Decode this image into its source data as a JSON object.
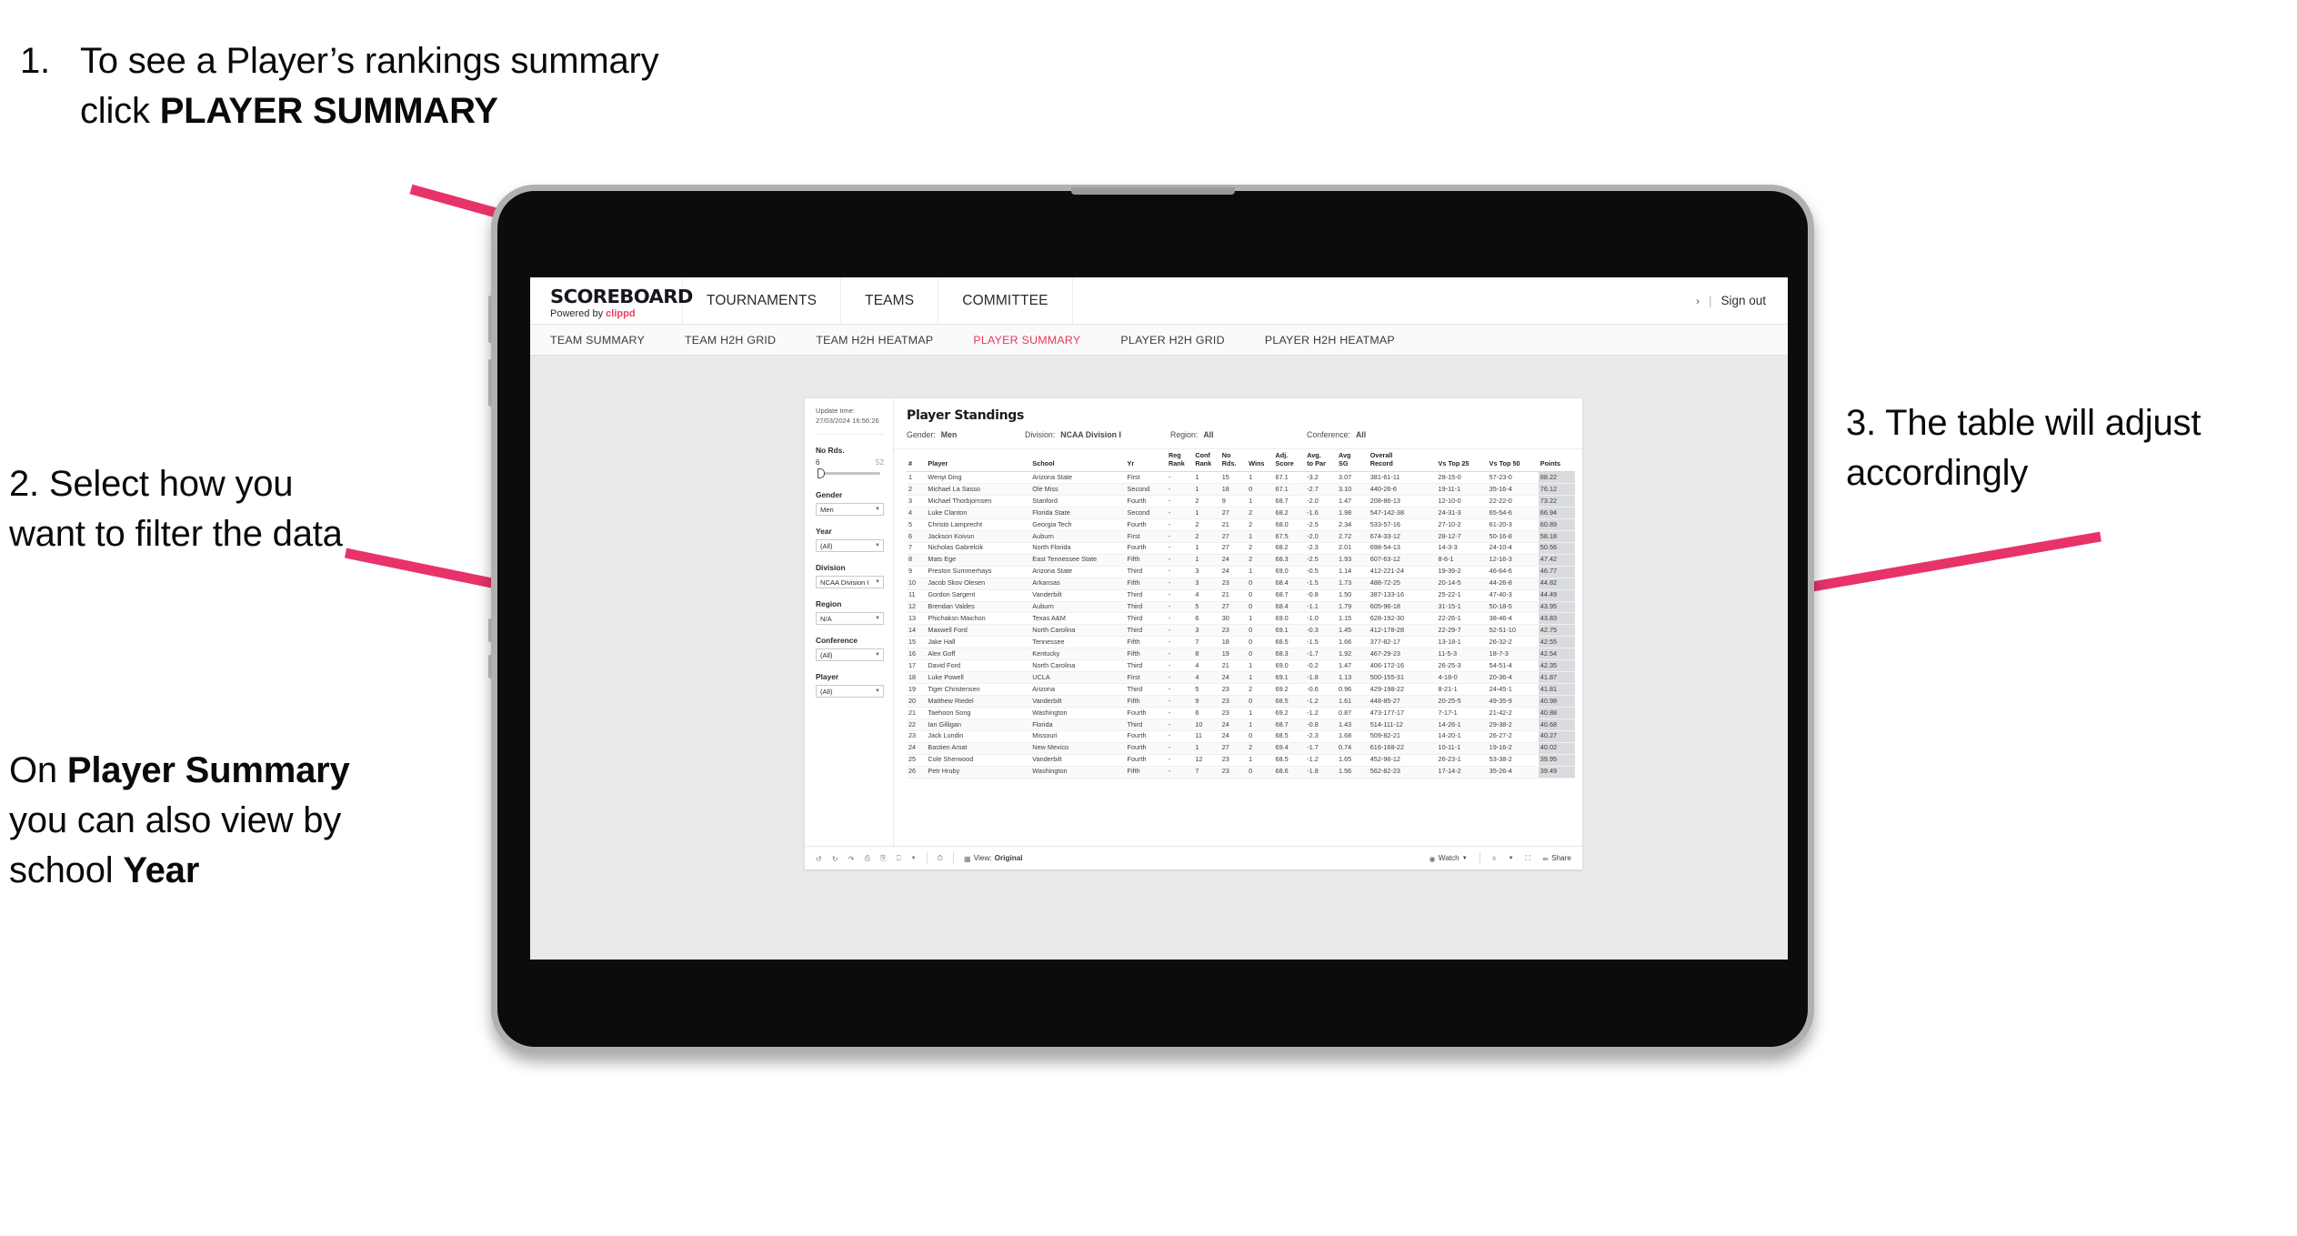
{
  "annotations": {
    "step1": {
      "number": "1.",
      "text_before": "To see a Player’s rankings summary click ",
      "bold": "PLAYER SUMMARY"
    },
    "step2": {
      "text": "2. Select how you want to filter the data"
    },
    "step2b": {
      "pre": "On ",
      "bold1": "Player Summary",
      "mid": " you can also view by school ",
      "bold2": "Year"
    },
    "step3": {
      "text": "3. The table will adjust accordingly"
    },
    "arrow_color": "#e8336a"
  },
  "app": {
    "brand": {
      "title": "SCOREBOARD",
      "powered_prefix": "Powered by ",
      "powered_brand": "clippd"
    },
    "top_nav": [
      {
        "label": "TOURNAMENTS"
      },
      {
        "label": "TEAMS"
      },
      {
        "label": "COMMITTEE"
      }
    ],
    "account": {
      "caret": "›",
      "separator": "|",
      "sign_out": "Sign out"
    },
    "sub_nav": [
      {
        "label": "TEAM SUMMARY",
        "active": false
      },
      {
        "label": "TEAM H2H GRID",
        "active": false
      },
      {
        "label": "TEAM H2H HEATMAP",
        "active": false
      },
      {
        "label": "PLAYER SUMMARY",
        "active": true
      },
      {
        "label": "PLAYER H2H GRID",
        "active": false
      },
      {
        "label": "PLAYER H2H HEATMAP",
        "active": false
      }
    ],
    "accent_color": "#e8365f"
  },
  "viz": {
    "update": {
      "label": "Update time:",
      "value": "27/03/2024 16:56:26"
    },
    "title": "Player Standings",
    "meta": [
      {
        "label": "Gender:",
        "value": "Men"
      },
      {
        "label": "Division:",
        "value": "NCAA Division I"
      },
      {
        "label": "Region:",
        "value": "All"
      },
      {
        "label": "Conference:",
        "value": "All"
      }
    ],
    "filters": {
      "rounds": {
        "label": "No Rds.",
        "min": "6",
        "max": "52"
      },
      "selects": [
        {
          "label": "Gender",
          "value": "Men"
        },
        {
          "label": "Year",
          "value": "(All)"
        },
        {
          "label": "Division",
          "value": "NCAA Division I"
        },
        {
          "label": "Region",
          "value": "N/A"
        },
        {
          "label": "Conference",
          "value": "(All)"
        },
        {
          "label": "Player",
          "value": "(All)"
        }
      ]
    },
    "footer": {
      "view_label": "View:",
      "view_value": "Original",
      "watch": "Watch",
      "share": "Share"
    }
  },
  "chart_data": {
    "type": "table",
    "title": "Player Standings",
    "columns": [
      "#",
      "Player",
      "School",
      "Yr",
      "Reg Rank",
      "Conf Rank",
      "No Rds.",
      "Wins",
      "Adj. Score",
      "Avg. to Par",
      "Avg SG",
      "Overall Record",
      "Vs Top 25",
      "Vs Top 50",
      "Points"
    ],
    "column_headers_two_line": [
      {
        "l1": "#",
        "l2": ""
      },
      {
        "l1": "Player",
        "l2": ""
      },
      {
        "l1": "School",
        "l2": ""
      },
      {
        "l1": "Yr",
        "l2": ""
      },
      {
        "l1": "Reg",
        "l2": "Rank"
      },
      {
        "l1": "Conf",
        "l2": "Rank"
      },
      {
        "l1": "No",
        "l2": "Rds."
      },
      {
        "l1": "Wins",
        "l2": ""
      },
      {
        "l1": "Adj.",
        "l2": "Score"
      },
      {
        "l1": "Avg.",
        "l2": "to Par"
      },
      {
        "l1": "Avg",
        "l2": "SG"
      },
      {
        "l1": "Overall",
        "l2": "Record"
      },
      {
        "l1": "Vs Top 25",
        "l2": ""
      },
      {
        "l1": "Vs Top 50",
        "l2": ""
      },
      {
        "l1": "Points",
        "l2": ""
      }
    ],
    "rows": [
      [
        "1",
        "Wenyi Ding",
        "Arizona State",
        "First",
        "-",
        "1",
        "15",
        "1",
        "67.1",
        "-3.2",
        "3.07",
        "381-61-11",
        "28-15-0",
        "57-23-0",
        "88.22"
      ],
      [
        "2",
        "Michael La Sasso",
        "Ole Miss",
        "Second",
        "-",
        "1",
        "18",
        "0",
        "67.1",
        "-2.7",
        "3.10",
        "440-26-6",
        "19-11-1",
        "35-16-4",
        "76.12"
      ],
      [
        "3",
        "Michael Thorbjornsen",
        "Stanford",
        "Fourth",
        "-",
        "2",
        "9",
        "1",
        "68.7",
        "-2.0",
        "1.47",
        "208-86-13",
        "12-10-0",
        "22-22-0",
        "73.22"
      ],
      [
        "4",
        "Luke Clanton",
        "Florida State",
        "Second",
        "-",
        "1",
        "27",
        "2",
        "68.2",
        "-1.6",
        "1.98",
        "547-142-38",
        "24-31-3",
        "65-54-6",
        "66.94"
      ],
      [
        "5",
        "Christo Lamprecht",
        "Georgia Tech",
        "Fourth",
        "-",
        "2",
        "21",
        "2",
        "68.0",
        "-2.5",
        "2.34",
        "533-57-16",
        "27-10-2",
        "61-20-3",
        "60.89"
      ],
      [
        "6",
        "Jackson Koivun",
        "Auburn",
        "First",
        "-",
        "2",
        "27",
        "1",
        "67.5",
        "-2.0",
        "2.72",
        "674-33-12",
        "28-12-7",
        "50-16-8",
        "58.18"
      ],
      [
        "7",
        "Nicholas Gabrelcik",
        "North Florida",
        "Fourth",
        "-",
        "1",
        "27",
        "2",
        "68.2",
        "-2.3",
        "2.01",
        "698-54-13",
        "14-3-3",
        "24-10-4",
        "50.56"
      ],
      [
        "8",
        "Mats Ege",
        "East Tennessee State",
        "Fifth",
        "-",
        "1",
        "24",
        "2",
        "68.3",
        "-2.5",
        "1.93",
        "607-63-12",
        "8-6-1",
        "12-16-3",
        "47.42"
      ],
      [
        "9",
        "Preston Summerhays",
        "Arizona State",
        "Third",
        "-",
        "3",
        "24",
        "1",
        "69.0",
        "-0.5",
        "1.14",
        "412-221-24",
        "19-39-2",
        "46-64-6",
        "46.77"
      ],
      [
        "10",
        "Jacob Skov Olesen",
        "Arkansas",
        "Fifth",
        "-",
        "3",
        "23",
        "0",
        "68.4",
        "-1.5",
        "1.73",
        "488-72-25",
        "20-14-5",
        "44-26-8",
        "44.82"
      ],
      [
        "11",
        "Gordon Sargent",
        "Vanderbilt",
        "Third",
        "-",
        "4",
        "21",
        "0",
        "68.7",
        "-0.8",
        "1.50",
        "387-133-16",
        "25-22-1",
        "47-40-3",
        "44.49"
      ],
      [
        "12",
        "Brendan Valdes",
        "Auburn",
        "Third",
        "-",
        "5",
        "27",
        "0",
        "68.4",
        "-1.1",
        "1.79",
        "605-96-18",
        "31-15-1",
        "50-18-5",
        "43.95"
      ],
      [
        "13",
        "Phichaksn Maichon",
        "Texas A&M",
        "Third",
        "-",
        "6",
        "30",
        "1",
        "69.0",
        "-1.0",
        "1.15",
        "628-192-30",
        "22-26-1",
        "38-46-4",
        "43.83"
      ],
      [
        "14",
        "Maxwell Ford",
        "North Carolina",
        "Third",
        "-",
        "3",
        "23",
        "0",
        "69.1",
        "-0.3",
        "1.45",
        "412-178-28",
        "22-29-7",
        "52-51-10",
        "42.75"
      ],
      [
        "15",
        "Jake Hall",
        "Tennessee",
        "Fifth",
        "-",
        "7",
        "18",
        "0",
        "68.5",
        "-1.5",
        "1.66",
        "377-82-17",
        "13-18-1",
        "26-32-2",
        "42.55"
      ],
      [
        "16",
        "Alex Goff",
        "Kentucky",
        "Fifth",
        "-",
        "8",
        "19",
        "0",
        "68.3",
        "-1.7",
        "1.92",
        "467-29-23",
        "11-5-3",
        "18-7-3",
        "42.54"
      ],
      [
        "17",
        "David Ford",
        "North Carolina",
        "Third",
        "-",
        "4",
        "21",
        "1",
        "69.0",
        "-0.2",
        "1.47",
        "406-172-16",
        "26-25-3",
        "54-51-4",
        "42.35"
      ],
      [
        "18",
        "Luke Powell",
        "UCLA",
        "First",
        "-",
        "4",
        "24",
        "1",
        "69.1",
        "-1.8",
        "1.13",
        "500-155-31",
        "4-18-0",
        "20-36-4",
        "41.87"
      ],
      [
        "19",
        "Tiger Christensen",
        "Arizona",
        "Third",
        "-",
        "5",
        "23",
        "2",
        "69.2",
        "-0.6",
        "0.96",
        "429-198-22",
        "8-21-1",
        "24-45-1",
        "41.81"
      ],
      [
        "20",
        "Matthew Riedel",
        "Vanderbilt",
        "Fifth",
        "-",
        "9",
        "23",
        "0",
        "68.5",
        "-1.2",
        "1.61",
        "448-85-27",
        "20-25-5",
        "49-35-9",
        "40.98"
      ],
      [
        "21",
        "Taehoon Song",
        "Washington",
        "Fourth",
        "-",
        "6",
        "23",
        "1",
        "69.2",
        "-1.2",
        "0.87",
        "473-177-17",
        "7-17-1",
        "21-42-2",
        "40.88"
      ],
      [
        "22",
        "Ian Gilligan",
        "Florida",
        "Third",
        "-",
        "10",
        "24",
        "1",
        "68.7",
        "-0.8",
        "1.43",
        "514-111-12",
        "14-26-1",
        "29-38-2",
        "40.68"
      ],
      [
        "23",
        "Jack Lundin",
        "Missouri",
        "Fourth",
        "-",
        "11",
        "24",
        "0",
        "68.5",
        "-2.3",
        "1.68",
        "509-82-21",
        "14-20-1",
        "26-27-2",
        "40.27"
      ],
      [
        "24",
        "Bastien Amat",
        "New Mexico",
        "Fourth",
        "-",
        "1",
        "27",
        "2",
        "69.4",
        "-1.7",
        "0.74",
        "616-168-22",
        "10-11-1",
        "19-16-2",
        "40.02"
      ],
      [
        "25",
        "Cole Sherwood",
        "Vanderbilt",
        "Fourth",
        "-",
        "12",
        "23",
        "1",
        "68.5",
        "-1.2",
        "1.65",
        "452-96-12",
        "26-23-1",
        "53-38-2",
        "39.95"
      ],
      [
        "26",
        "Petr Hruby",
        "Washington",
        "Fifth",
        "-",
        "7",
        "23",
        "0",
        "68.6",
        "-1.8",
        "1.56",
        "562-82-23",
        "17-14-2",
        "35-26-4",
        "39.49"
      ]
    ]
  }
}
